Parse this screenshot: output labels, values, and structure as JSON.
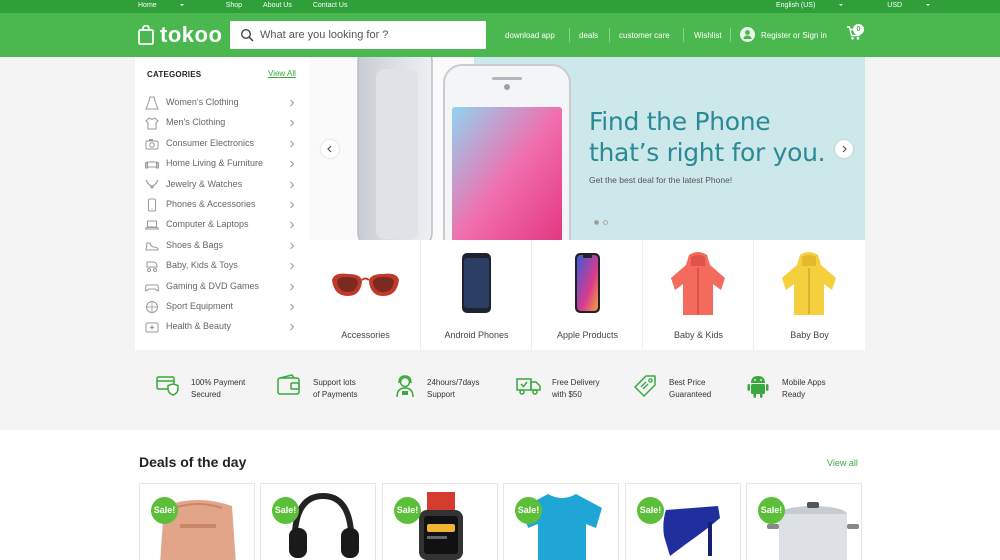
{
  "topbar": {
    "left": [
      {
        "label": "Home",
        "dropdown": true
      },
      {
        "label": "Shop",
        "dropdown": false
      },
      {
        "label": "About Us",
        "dropdown": false
      },
      {
        "label": "Contact Us",
        "dropdown": false
      }
    ],
    "language": "English (US)",
    "currency": "USD"
  },
  "header": {
    "logo": "tokoo",
    "search_placeholder": "What are you looking for ?",
    "nav": [
      "download app",
      "deals",
      "customer care",
      "Wishlist"
    ],
    "account": "Register or Sign in",
    "cart_count": "0"
  },
  "categories": {
    "title": "CATEGORIES",
    "view_all": "View All",
    "items": [
      {
        "label": "Women's Clothing",
        "icon": "dress-icon"
      },
      {
        "label": "Men's Clothing",
        "icon": "shirt-icon"
      },
      {
        "label": "Consumer Electronics",
        "icon": "camera-icon"
      },
      {
        "label": "Home Living & Furniture",
        "icon": "sofa-icon"
      },
      {
        "label": "Jewelry & Watches",
        "icon": "necklace-icon"
      },
      {
        "label": "Phones & Accessories",
        "icon": "phone-icon"
      },
      {
        "label": "Computer & Laptops",
        "icon": "laptop-icon"
      },
      {
        "label": "Shoes & Bags",
        "icon": "shoe-icon"
      },
      {
        "label": "Baby, Kids & Toys",
        "icon": "stroller-icon"
      },
      {
        "label": "Gaming & DVD Games",
        "icon": "gamepad-icon"
      },
      {
        "label": "Sport Equipment",
        "icon": "ball-icon"
      },
      {
        "label": "Health & Beauty",
        "icon": "health-icon"
      }
    ]
  },
  "hero": {
    "title_line1": "Find the Phone",
    "title_line2": "that’s right for you.",
    "subtitle": "Get the best deal for the latest Phone!"
  },
  "product_categories": [
    {
      "label": "Accessories"
    },
    {
      "label": "Android Phones"
    },
    {
      "label": "Apple Products"
    },
    {
      "label": "Baby & Kids"
    },
    {
      "label": "Baby Boy"
    }
  ],
  "features": [
    {
      "line1": "100% Payment",
      "line2": "Secured",
      "icon": "shield-card-icon"
    },
    {
      "line1": "Support lots",
      "line2": "of Payments",
      "icon": "wallet-icon"
    },
    {
      "line1": "24hours/7days",
      "line2": "Support",
      "icon": "support-agent-icon"
    },
    {
      "line1": "Free Delivery",
      "line2": "with $50",
      "icon": "truck-icon"
    },
    {
      "line1": "Best Price",
      "line2": "Guaranteed",
      "icon": "price-tag-icon"
    },
    {
      "line1": "Mobile Apps",
      "line2": "Ready",
      "icon": "android-icon"
    }
  ],
  "deals": {
    "title": "Deals of the day",
    "view_all": "View all",
    "items": [
      {
        "badge": "Sale!",
        "product": "backpack"
      },
      {
        "badge": "Sale!",
        "product": "headphones"
      },
      {
        "badge": "Sale!",
        "product": "smartwatch"
      },
      {
        "badge": "Sale!",
        "product": "t-shirt"
      },
      {
        "badge": "Sale!",
        "product": "high-heel-shoe"
      },
      {
        "badge": "Sale!",
        "product": "cooking-pot"
      }
    ]
  },
  "colors": {
    "brand_green": "#4bb84f",
    "topbar_green": "#2f9f3a",
    "hero_teal": "#2a8a95",
    "hero_bg": "#cde8ea"
  }
}
